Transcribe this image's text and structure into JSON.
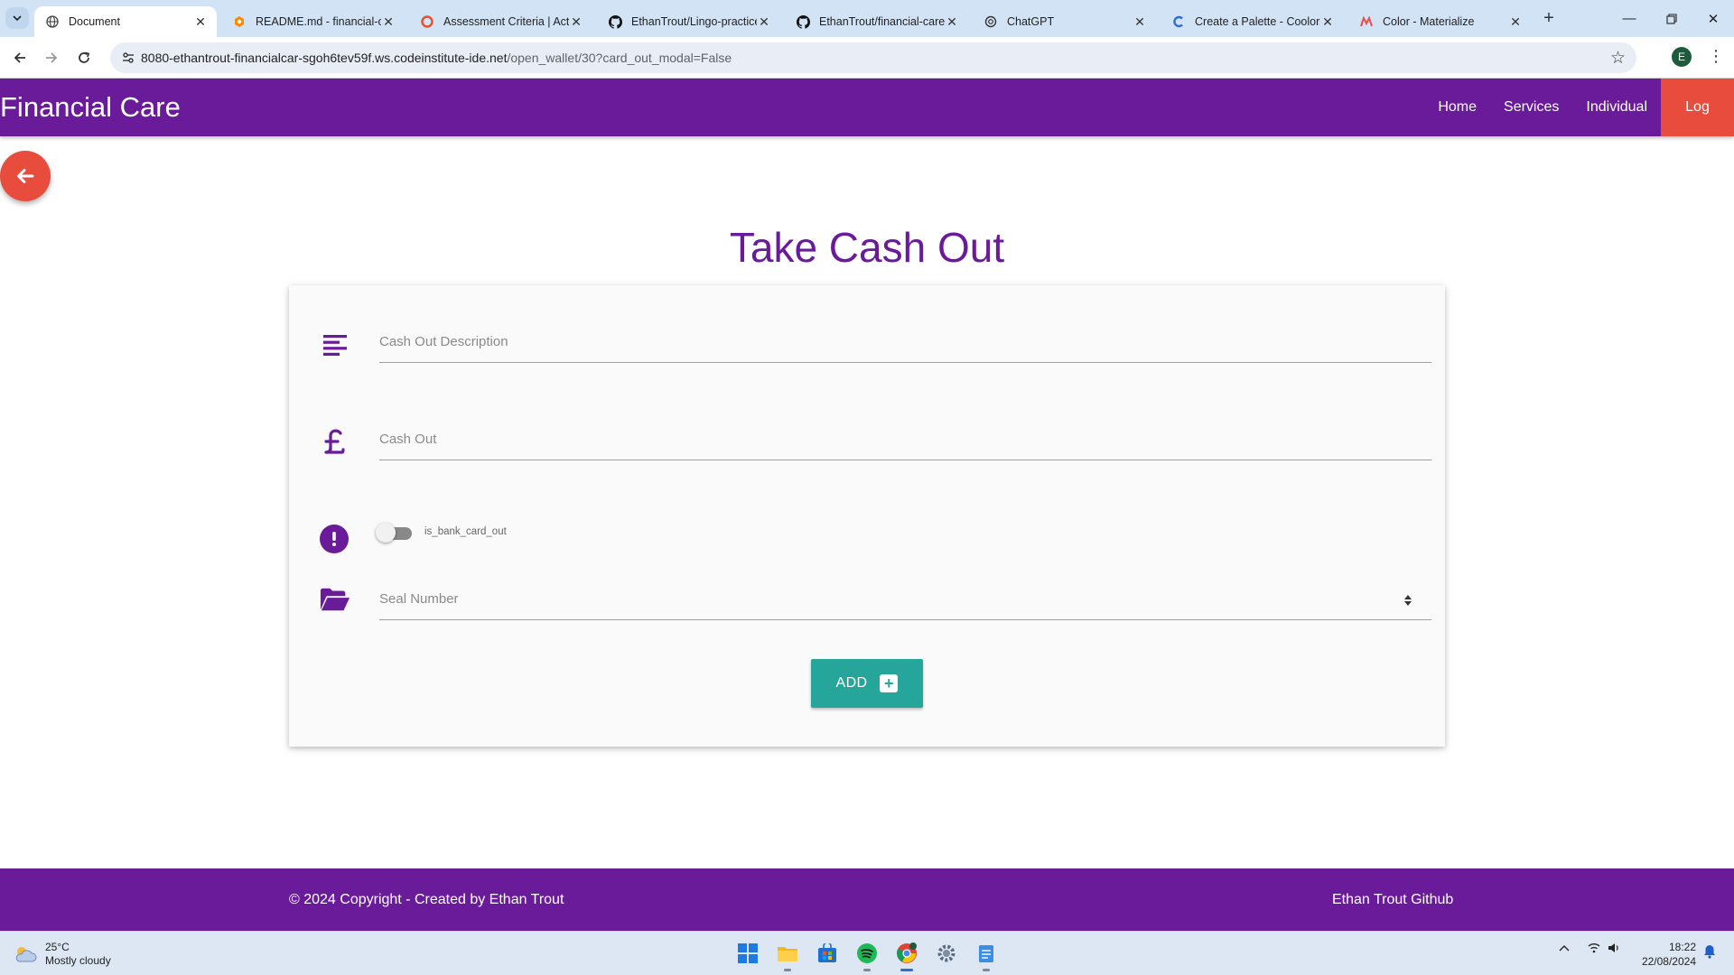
{
  "browser": {
    "tabs": [
      {
        "title": "Document",
        "icon": "globe-icon"
      },
      {
        "title": "README.md - financial-ca",
        "icon": "gitpod-icon"
      },
      {
        "title": "Assessment Criteria | Acti",
        "icon": "lms-icon"
      },
      {
        "title": "EthanTrout/Lingo-practice",
        "icon": "github-icon"
      },
      {
        "title": "EthanTrout/financial-care",
        "icon": "github-icon"
      },
      {
        "title": "ChatGPT",
        "icon": "chatgpt-icon"
      },
      {
        "title": "Create a Palette - Coolors",
        "icon": "coolors-icon"
      },
      {
        "title": "Color - Materialize",
        "icon": "materialize-icon"
      }
    ],
    "url_host": "8080-ethantrout-financialcar-sgoh6tev59f.ws.codeinstitute-ide.net",
    "url_path": "/open_wallet/30?card_out_modal=False",
    "profile_initial": "E"
  },
  "navbar": {
    "brand": "Financial Care",
    "links": [
      "Home",
      "Services",
      "Individual",
      "Log out"
    ]
  },
  "form": {
    "title": "Take Cash Out",
    "description_placeholder": "Cash Out Description",
    "cash_out_placeholder": "Cash Out",
    "switch_label": "is_bank_card_out",
    "switch_on": false,
    "seal_placeholder": "Seal Number",
    "add_label": "ADD"
  },
  "footer": {
    "copyright": "© 2024 Copyright - Created by Ethan Trout",
    "github_link": "Ethan Trout Github"
  },
  "taskbar": {
    "temperature": "25°C",
    "weather": "Mostly cloudy",
    "time": "18:22",
    "date": "22/08/2024"
  },
  "colors": {
    "brand_purple": "#6a1b9a",
    "logout_red": "#e74c3c",
    "add_teal": "#26a69a"
  }
}
